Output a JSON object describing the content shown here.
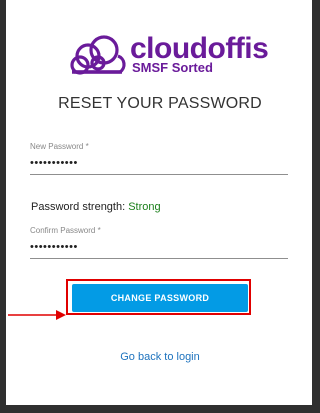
{
  "brand": {
    "name": "cloudoffis",
    "tagline": "SMSF Sorted",
    "color": "#6a1b9a",
    "icon": "cloud-logo-icon"
  },
  "page": {
    "title": "RESET YOUR PASSWORD"
  },
  "form": {
    "new_password": {
      "label": "New Password *",
      "value": "•••••••••••"
    },
    "strength": {
      "label": "Password strength:",
      "value": "Strong",
      "color": "#1a7f1a"
    },
    "confirm_password": {
      "label": "Confirm Password *",
      "value": "•••••••••••"
    },
    "submit_label": "CHANGE PASSWORD",
    "button_color": "#039be5"
  },
  "annotation": {
    "highlight_color": "#e00000"
  },
  "footer": {
    "back_link": "Go back to login"
  }
}
